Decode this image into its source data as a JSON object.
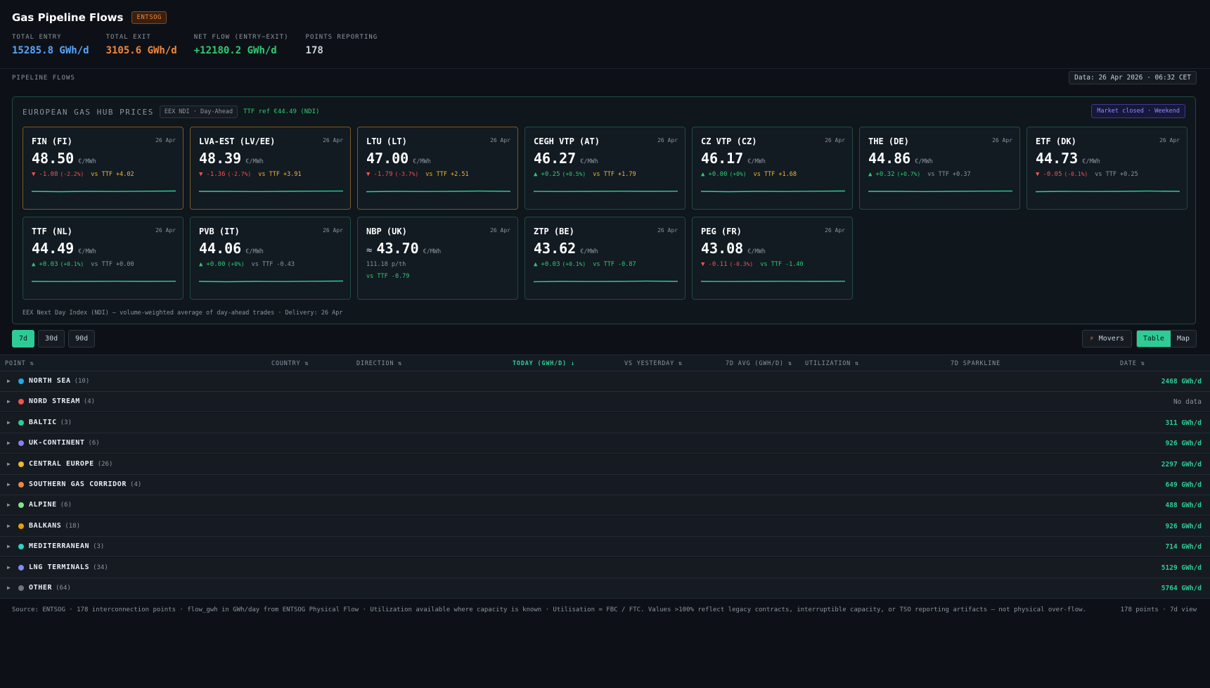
{
  "header": {
    "title": "Gas Pipeline Flows",
    "source_badge": "ENTSOG",
    "stats": [
      {
        "label": "TOTAL ENTRY",
        "value": "15285.8 GWh/d",
        "color": "#58a6ff"
      },
      {
        "label": "TOTAL EXIT",
        "value": "3105.6 GWh/d",
        "color": "#f0883e"
      },
      {
        "label": "NET FLOW (ENTRY−EXIT)",
        "value": "+12180.2 GWh/d",
        "color": "#2ecc71"
      },
      {
        "label": "POINTS REPORTING",
        "value": "178",
        "color": "#c9d1d9"
      }
    ]
  },
  "section_label": "PIPELINE FLOWS",
  "data_date": "Data: 26 Apr 2026 · 06:32 CET",
  "hub": {
    "title": "EUROPEAN GAS HUB PRICES",
    "tag": "EEX NDI · Day-Ahead",
    "ref": "TTF ref €44.49 (NDI)",
    "market_status": "Market closed · Weekend",
    "footnote": "EEX Next Day Index (NDI) — volume-weighted average of day-ahead trades · Delivery: 26 Apr",
    "cards": [
      {
        "name": "FIN (FI)",
        "date": "26 Apr",
        "price": "48.50",
        "unit": "€/MWh",
        "arrow": "▼",
        "delta": "-1.08",
        "pct": "(-2.2%)",
        "vs": "vs TTF +4.02",
        "dir": "down",
        "vs_color": "amber",
        "warn": true
      },
      {
        "name": "LVA-EST (LV/EE)",
        "date": "26 Apr",
        "price": "48.39",
        "unit": "€/MWh",
        "arrow": "▼",
        "delta": "-1.36",
        "pct": "(-2.7%)",
        "vs": "vs TTF +3.91",
        "dir": "down",
        "vs_color": "amber",
        "warn": true
      },
      {
        "name": "LTU (LT)",
        "date": "26 Apr",
        "price": "47.00",
        "unit": "€/MWh",
        "arrow": "▼",
        "delta": "-1.79",
        "pct": "(-3.7%)",
        "vs": "vs TTF +2.51",
        "dir": "down",
        "vs_color": "amber",
        "warn": true
      },
      {
        "name": "CEGH VTP (AT)",
        "date": "26 Apr",
        "price": "46.27",
        "unit": "€/MWh",
        "arrow": "▲",
        "delta": "+0.25",
        "pct": "(+0.5%)",
        "vs": "vs TTF +1.79",
        "dir": "up",
        "vs_color": "amber",
        "warn": false
      },
      {
        "name": "CZ VTP (CZ)",
        "date": "26 Apr",
        "price": "46.17",
        "unit": "€/MWh",
        "arrow": "▲",
        "delta": "+0.00",
        "pct": "(+0%)",
        "vs": "vs TTF +1.68",
        "dir": "up",
        "vs_color": "amber",
        "warn": false
      },
      {
        "name": "THE (DE)",
        "date": "26 Apr",
        "price": "44.86",
        "unit": "€/MWh",
        "arrow": "▲",
        "delta": "+0.32",
        "pct": "(+0.7%)",
        "vs": "vs TTF +0.37",
        "dir": "up",
        "vs_color": "muted",
        "warn": false
      },
      {
        "name": "ETF (DK)",
        "date": "26 Apr",
        "price": "44.73",
        "unit": "€/MWh",
        "arrow": "▼",
        "delta": "-0.05",
        "pct": "(-0.1%)",
        "vs": "vs TTF +0.25",
        "dir": "down",
        "vs_color": "muted",
        "warn": false
      },
      {
        "name": "TTF (NL)",
        "date": "26 Apr",
        "price": "44.49",
        "unit": "€/MWh",
        "arrow": "▲",
        "delta": "+0.03",
        "pct": "(+0.1%)",
        "vs": "vs TTF +0.00",
        "dir": "up",
        "vs_color": "muted",
        "warn": false
      },
      {
        "name": "PVB (IT)",
        "date": "26 Apr",
        "price": "44.06",
        "unit": "€/MWh",
        "arrow": "▲",
        "delta": "+0.00",
        "pct": "(+0%)",
        "vs": "vs TTF -0.43",
        "dir": "up",
        "vs_color": "muted",
        "warn": false
      },
      {
        "name": "NBP (UK)",
        "date": "26 Apr",
        "price": "43.70",
        "unit": "€/MWh",
        "approx": "≈",
        "sub": "111.18 p/th",
        "vs": "vs TTF -0.79",
        "vs_color": "up",
        "warn": false
      },
      {
        "name": "ZTP (BE)",
        "date": "26 Apr",
        "price": "43.62",
        "unit": "€/MWh",
        "arrow": "▲",
        "delta": "+0.03",
        "pct": "(+0.1%)",
        "vs": "vs TTF -0.87",
        "dir": "up",
        "vs_color": "up",
        "warn": false
      },
      {
        "name": "PEG (FR)",
        "date": "26 Apr",
        "price": "43.08",
        "unit": "€/MWh",
        "arrow": "▼",
        "delta": "-0.11",
        "pct": "(-0.3%)",
        "vs": "vs TTF -1.40",
        "dir": "down",
        "vs_color": "up",
        "warn": false
      }
    ]
  },
  "controls": {
    "ranges": [
      "7d",
      "30d",
      "90d"
    ],
    "active_range": "7d",
    "movers_label": "Movers",
    "view_table": "Table",
    "view_map": "Map"
  },
  "table": {
    "columns": {
      "point": "POINT ⇅",
      "country": "COUNTRY ⇅",
      "direction": "DIRECTION ⇅",
      "today": "TODAY (GWH/D) ↓",
      "vs_yesterday": "VS YESTERDAY ⇅",
      "avg7d": "7D AVG (GWH/D) ⇅",
      "utilization": "UTILIZATION ⇅",
      "sparkline": "7D SPARKLINE",
      "date": "DATE ⇅"
    },
    "groups": [
      {
        "name": "NORTH SEA",
        "count": "(10)",
        "value": "2468 GWh/d",
        "color": "#1fa8f0"
      },
      {
        "name": "NORD STREAM",
        "count": "(4)",
        "value": "No data",
        "color": "#f85149",
        "nodata": true
      },
      {
        "name": "BALTIC",
        "count": "(3)",
        "value": "311 GWh/d",
        "color": "#2ecc95"
      },
      {
        "name": "UK-CONTINENT",
        "count": "(6)",
        "value": "926 GWh/d",
        "color": "#8b7cf6"
      },
      {
        "name": "CENTRAL EUROPE",
        "count": "(26)",
        "value": "2297 GWh/d",
        "color": "#f0b72f"
      },
      {
        "name": "SOUTHERN GAS CORRIDOR",
        "count": "(4)",
        "value": "649 GWh/d",
        "color": "#f0883e"
      },
      {
        "name": "ALPINE",
        "count": "(6)",
        "value": "488 GWh/d",
        "color": "#7ee787"
      },
      {
        "name": "BALKANS",
        "count": "(18)",
        "value": "926 GWh/d",
        "color": "#e3a008"
      },
      {
        "name": "MEDITERRANEAN",
        "count": "(3)",
        "value": "714 GWh/d",
        "color": "#2dd4bf"
      },
      {
        "name": "LNG TERMINALS",
        "count": "(34)",
        "value": "5129 GWh/d",
        "color": "#818cf8"
      },
      {
        "name": "OTHER",
        "count": "(64)",
        "value": "5764 GWh/d",
        "color": "#6e7681"
      }
    ]
  },
  "footer": {
    "source": "Source: ENTSOG · 178 interconnection points · flow_gwh in GWh/day from ENTSOG Physical Flow · Utilization available where capacity is known · Utilisation = FBC / FTC. Values >100% reflect legacy contracts, interruptible capacity, or TSO reporting artifacts — not physical over-flow.",
    "summary": "178 points · 7d view"
  },
  "colors": {
    "accent": "#2ecc95",
    "up": "#2ecc71",
    "down": "#f85149",
    "warn_border": "#7a5a22"
  }
}
